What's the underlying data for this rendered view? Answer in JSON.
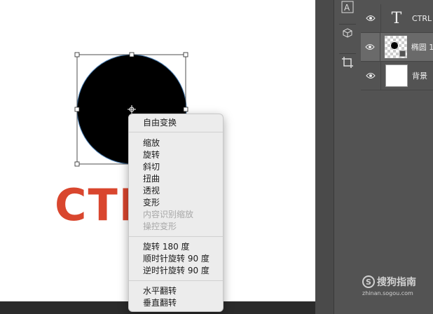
{
  "layers": [
    {
      "name": "CTRL",
      "type": "text"
    },
    {
      "name": "椭圆 1",
      "type": "shape",
      "selected": true
    },
    {
      "name": "背景",
      "type": "background"
    }
  ],
  "canvas": {
    "text": "CTRL",
    "text_color": "#d9462e",
    "shape_color": "#000000"
  },
  "context_menu": {
    "group1": [
      "自由变换"
    ],
    "group2": [
      {
        "label": "缩放",
        "enabled": true
      },
      {
        "label": "旋转",
        "enabled": true
      },
      {
        "label": "斜切",
        "enabled": true
      },
      {
        "label": "扭曲",
        "enabled": true
      },
      {
        "label": "透视",
        "enabled": true
      },
      {
        "label": "变形",
        "enabled": true
      },
      {
        "label": "内容识别缩放",
        "enabled": false
      },
      {
        "label": "操控变形",
        "enabled": false
      }
    ],
    "group3": [
      "旋转 180 度",
      "顺时针旋转 90 度",
      "逆时针旋转 90 度"
    ],
    "group4": [
      "水平翻转",
      "垂直翻转"
    ]
  },
  "watermark": {
    "name": "搜狗指南",
    "url": "zhinan.sogou.com"
  }
}
